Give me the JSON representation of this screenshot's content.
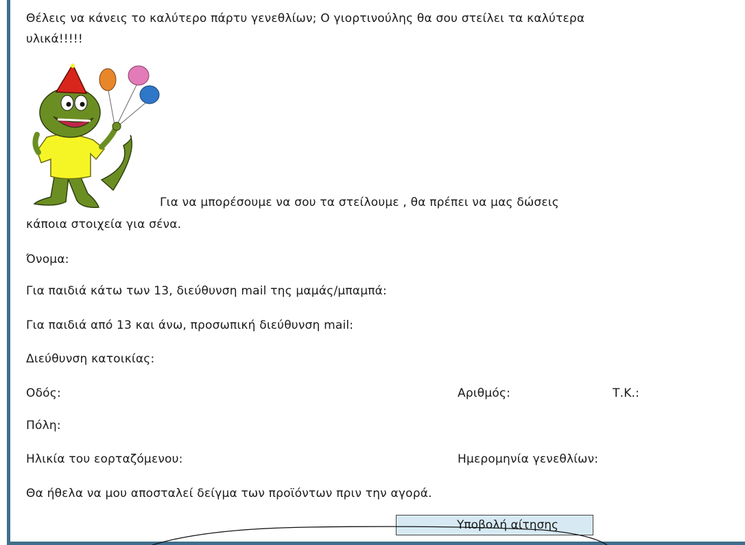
{
  "intro": {
    "line1": "Θέλεις να κάνεις το καλύτερο πάρτυ γενεθλίων; Ο γιορτινούλης θα σου στείλει τα καλύτερα",
    "line2": "υλικά!!!!!"
  },
  "note": {
    "line1": "Για να μπορέσουμε να σου τα στείλουμε , θα πρέπει να μας δώσεις",
    "line2": "κάποια στοιχεία για σένα."
  },
  "form": {
    "name_label": "Όνομα:",
    "parent_email_label": "Για παιδιά κάτω των 13, διεύθυνση mail της μαμάς/μπαμπά:",
    "personal_email_label": "Για παιδιά από 13 και άνω, προσωπική διεύθυνση mail:",
    "address_label": "Διεύθυνση κατοικίας:",
    "street_label": "Οδός:",
    "number_label": "Αριθμός:",
    "postal_label": "Τ.Κ.:",
    "city_label": "Πόλη:",
    "age_label": "Ηλικία του εορταζόμενου:",
    "birthday_label": "Ημερομηνία γενεθλίων:",
    "sample_label": "Θα ήθελα να μου αποσταλεί δείγμα των προϊόντων πριν την αγορά.",
    "submit_label": "Υποβολή αίτησης"
  },
  "colors": {
    "frame": "#3f6f8c",
    "button_bg": "#d7eaf4",
    "hat": "#d9261c",
    "mascot_body": "#6b8e23",
    "shirt": "#f5f526",
    "balloon_orange": "#e8862a",
    "balloon_pink": "#e27bb8",
    "balloon_blue": "#2f77c9"
  }
}
